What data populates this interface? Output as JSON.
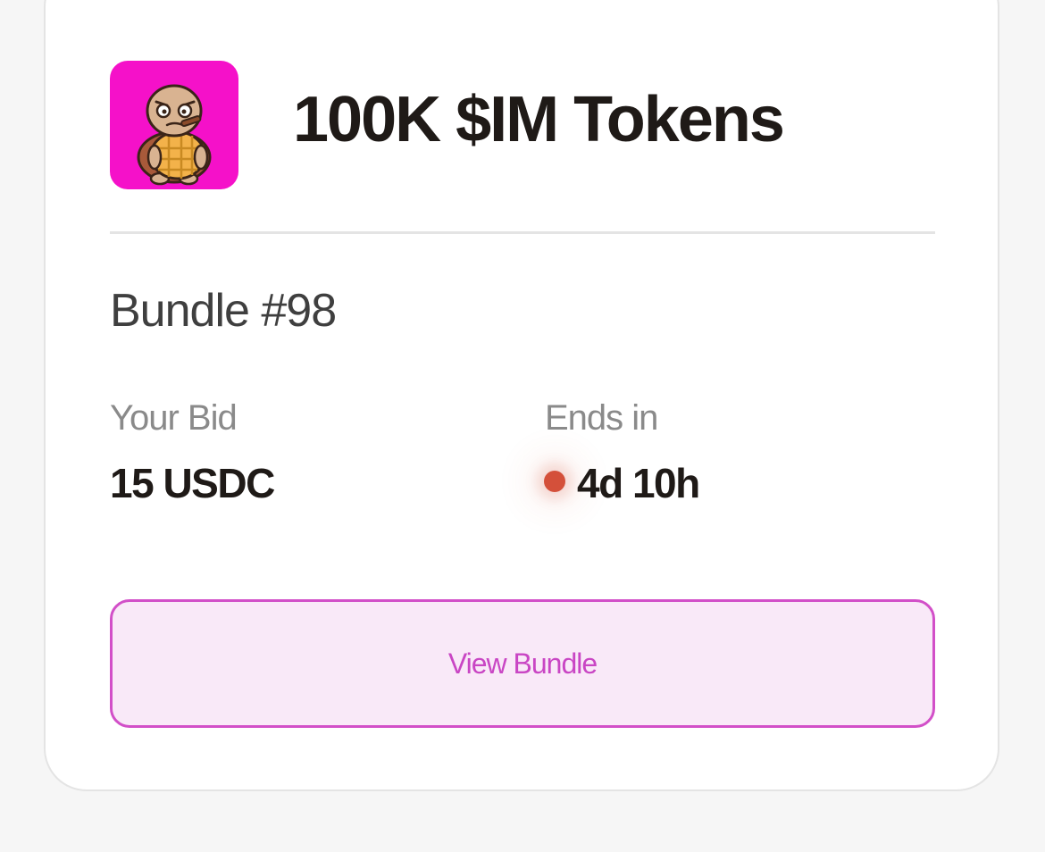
{
  "card": {
    "title": "100K $IM Tokens",
    "image_icon": "turtle-mascot-icon",
    "image_background": "#f511c9",
    "bundle_name": "Bundle #98",
    "bid_label": "Your Bid",
    "bid_value": "15 USDC",
    "ends_label": "Ends in",
    "ends_value": "4d 10h",
    "status_dot_color": "#d4503a",
    "button_label": "View Bundle",
    "button_accent": "#d24fc8"
  }
}
